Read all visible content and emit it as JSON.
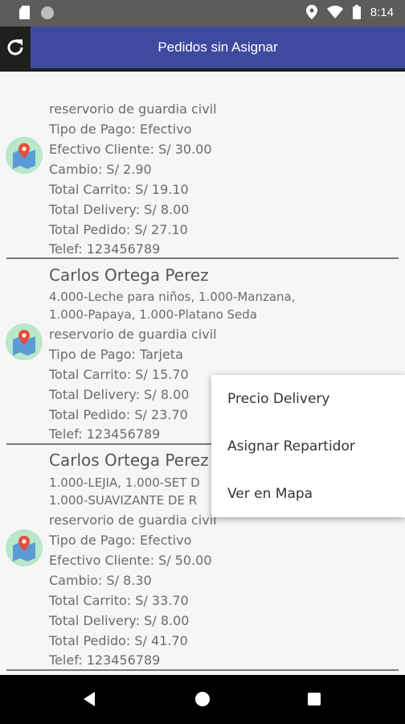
{
  "status_bar": {
    "time": "8:14",
    "icons": [
      "sd-card-icon",
      "circle-icon",
      "location-icon",
      "wifi-icon",
      "battery-icon"
    ]
  },
  "app_bar": {
    "title": "Pedidos sin Asignar",
    "refresh_icon": "refresh-icon",
    "color": "#3f4a9e"
  },
  "orders": [
    {
      "address": "reservorio de guardia civil",
      "pago": "Tipo de Pago: Efectivo",
      "efectivo": "Efectivo Cliente: S/ 30.00",
      "cambio": "Cambio: S/ 2.90",
      "carrito": "Total Carrito: S/ 19.10",
      "delivery": "Total Delivery: S/ 8.00",
      "pedido": "Total Pedido: S/ 27.10",
      "telef": "Telef: 123456789"
    },
    {
      "name": "Carlos Ortega Perez",
      "products_1": "4.000-Leche para niños, 1.000-Manzana,",
      "products_2": "1.000-Papaya, 1.000-Platano Seda",
      "address": "reservorio de guardia civil",
      "pago": "Tipo de Pago: Tarjeta",
      "carrito": "Total Carrito: S/ 15.70",
      "delivery": "Total Delivery: S/ 8.00",
      "pedido": "Total Pedido: S/ 23.70",
      "telef": "Telef: 123456789"
    },
    {
      "name": "Carlos Ortega Perez",
      "products_1": "1.000-LEJIA, 1.000-SET D",
      "products_2": "1.000-SUAVIZANTE DE R",
      "address": "reservorio de guardia civil",
      "pago": "Tipo de Pago: Efectivo",
      "efectivo": "Efectivo Cliente: S/ 50.00",
      "cambio": "Cambio: S/ 8.30",
      "carrito": "Total Carrito: S/ 33.70",
      "delivery": "Total Delivery: S/ 8.00",
      "pedido": "Total Pedido: S/ 41.70",
      "telef": "Telef: 123456789"
    }
  ],
  "context_menu": {
    "items": [
      "Precio Delivery",
      "Asignar Repartidor",
      "Ver en Mapa"
    ]
  },
  "nav_bar": {
    "icons": [
      "back-icon",
      "home-icon",
      "recents-icon"
    ]
  }
}
